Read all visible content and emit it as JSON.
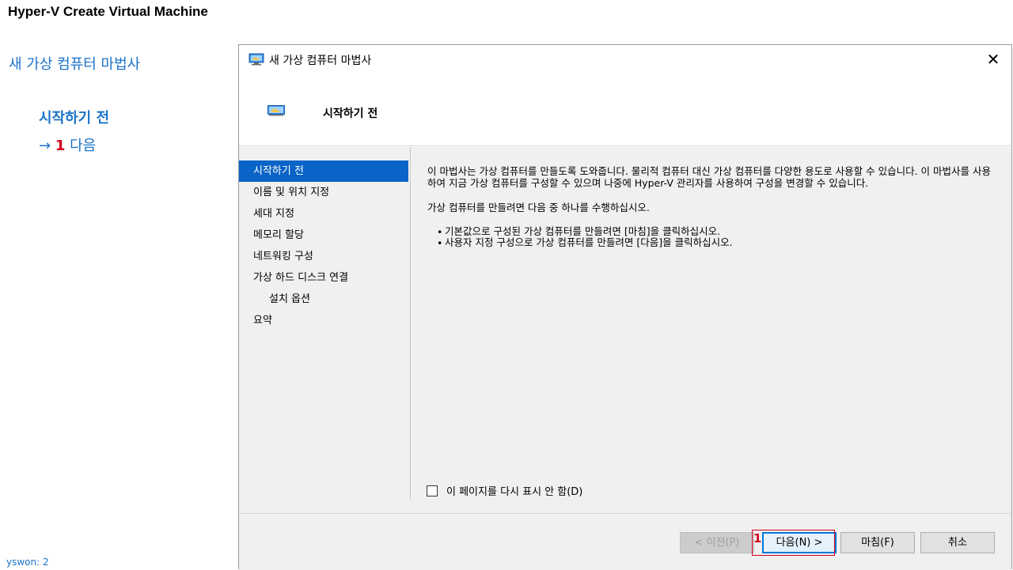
{
  "page": {
    "title": "Hyper-V Create Virtual Machine",
    "credit": "yswon:  2"
  },
  "sidebar": {
    "heading": "새 가상 컴퓨터 마법사",
    "current_step": "시작하기 전",
    "next_arrow": "→",
    "next_number": "1",
    "next_label": "다음"
  },
  "dialog": {
    "title": "새 가상 컴퓨터 마법사",
    "close_glyph": "✕",
    "header_title": "시작하기 전",
    "nav_items": [
      {
        "label": "시작하기 전",
        "active": true,
        "sub": false
      },
      {
        "label": "이름 및 위치 지정",
        "active": false,
        "sub": false
      },
      {
        "label": "세대 지정",
        "active": false,
        "sub": false
      },
      {
        "label": "메모리 할당",
        "active": false,
        "sub": false
      },
      {
        "label": "네트워킹 구성",
        "active": false,
        "sub": false
      },
      {
        "label": "가상 하드 디스크 연결",
        "active": false,
        "sub": false
      },
      {
        "label": "설치 옵션",
        "active": false,
        "sub": true
      },
      {
        "label": "요약",
        "active": false,
        "sub": false
      }
    ],
    "description_1": "이 마법사는 가상 컴퓨터를 만들도록 도와줍니다. 물리적 컴퓨터 대신 가상 컴퓨터를 다양한 용도로 사용할 수 있습니다. 이 마법사를 사용하여 지금 가상 컴퓨터를 구성할 수 있으며 나중에 Hyper-V 관리자를 사용하여 구성을 변경할 수 있습니다.",
    "description_2": "가상 컴퓨터를 만들려면 다음 중 하나를 수행하십시오.",
    "bullets": [
      "기본값으로 구성된 가상 컴퓨터를 만들려면 [마침]을 클릭하십시오.",
      "사용자 지정 구성으로 가상 컴퓨터를 만들려면 [다음]을 클릭하십시오."
    ],
    "checkbox_label": "이 페이지를 다시 표시 안 함(D)",
    "buttons": {
      "prev": "< 이전(P)",
      "next": "다음(N) >",
      "finish": "마침(F)",
      "cancel": "취소"
    },
    "annotation_number": "1"
  },
  "colors": {
    "accent_blue": "#1a73c8",
    "annotation_red": "#d6001c",
    "selection_blue": "#0a64c8"
  }
}
